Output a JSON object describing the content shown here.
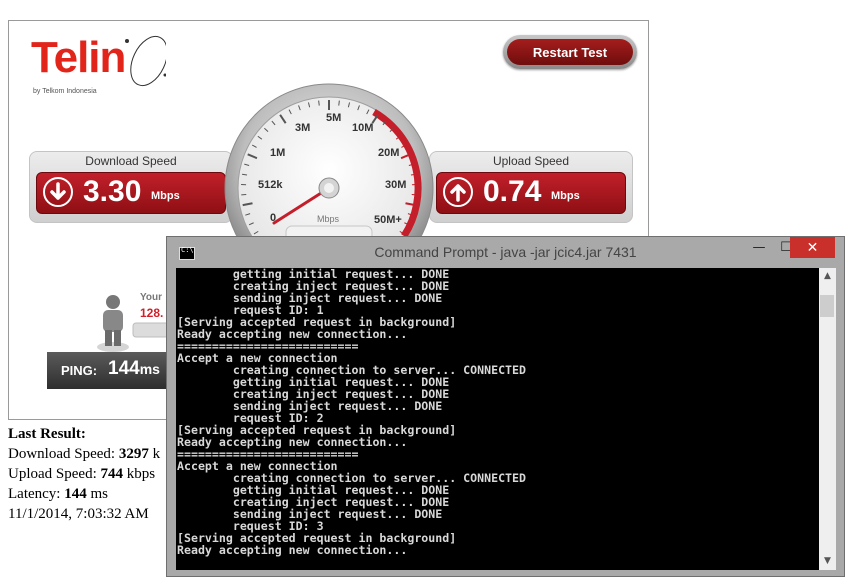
{
  "speedtest": {
    "logo_text": "Telin",
    "logo_sub": "by Telkom Indonesia",
    "restart_label": "Restart Test",
    "download": {
      "title": "Download Speed",
      "value": "3.30",
      "unit": "Mbps"
    },
    "upload": {
      "title": "Upload Speed",
      "value": "0.74",
      "unit": "Mbps"
    },
    "gauge": {
      "ticks": [
        "0",
        "512k",
        "1M",
        "3M",
        "5M",
        "10M",
        "20M",
        "30M",
        "50M+"
      ],
      "unit": "Mbps",
      "needle_value": "0"
    },
    "your_label": "Your",
    "your_value": "128.",
    "ping": {
      "label": "PING:",
      "value": "144",
      "unit": "ms"
    }
  },
  "last_result": {
    "title": "Last Result:",
    "download_label": "Download Speed: ",
    "download_value": "3297",
    "download_suffix": " k",
    "upload_label": "Upload Speed: ",
    "upload_value": "744",
    "upload_suffix": " kbps",
    "latency_label": "Latency: ",
    "latency_value": "144",
    "latency_suffix": " ms",
    "timestamp": "11/1/2014, 7:03:32 AM"
  },
  "cmd": {
    "title": "Command Prompt - java  -jar jcic4.jar 7431",
    "icon_text": "C:\\",
    "minimize": "—",
    "maximize": "☐",
    "close": "✕",
    "lines": [
      "        getting initial request... DONE",
      "        creating inject request... DONE",
      "        sending inject request... DONE",
      "        request ID: 1",
      "[Serving accepted request in background]",
      "Ready accepting new connection...",
      "==========================",
      "Accept a new connection",
      "        creating connection to server... CONNECTED",
      "        getting initial request... DONE",
      "        creating inject request... DONE",
      "        sending inject request... DONE",
      "        request ID: 2",
      "[Serving accepted request in background]",
      "Ready accepting new connection...",
      "==========================",
      "Accept a new connection",
      "        creating connection to server... CONNECTED",
      "        getting initial request... DONE",
      "        creating inject request... DONE",
      "        sending inject request... DONE",
      "        request ID: 3",
      "[Serving accepted request in background]",
      "Ready accepting new connection..."
    ]
  }
}
